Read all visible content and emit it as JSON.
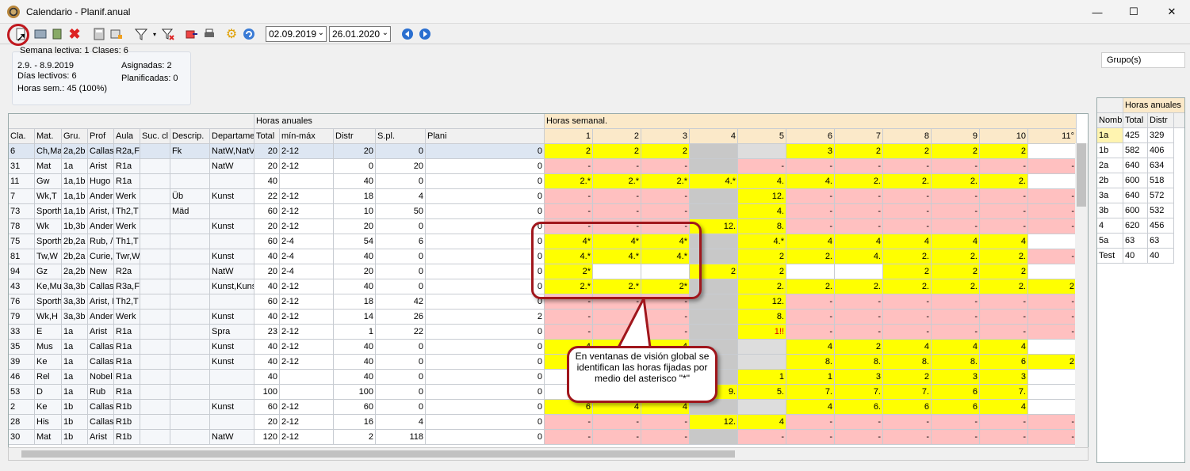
{
  "window": {
    "title": "Calendario - Planif.anual",
    "min": "—",
    "max": "☐",
    "close": "✕"
  },
  "toolbar": {
    "date_from": "02.09.2019",
    "date_to": "26.01.2020",
    "dropdown_arrow": "⌄"
  },
  "info": {
    "semana": "Semana lectiva: 1",
    "clases": "Clases: 6",
    "rango": "2.9. - 8.9.2019",
    "dias": "Días lectivos: 6",
    "horas": "Horas sem.: 45 (100%)",
    "asignadas": "Asignadas: 2",
    "planificadas": "Planificadas: 0"
  },
  "grid": {
    "group_header_annual": "Horas anuales",
    "group_header_weekly": "Horas semanal.",
    "columns": [
      "Cla.",
      "Mat.",
      "Gru.",
      "Prof",
      "Aula",
      "Suc. cl",
      "Descrip.",
      "Departame",
      "Total",
      "mín-máx",
      "Distr",
      "S.pl.",
      "Plani"
    ],
    "week_columns": [
      "1",
      "2",
      "3",
      "4",
      "5",
      "6",
      "7",
      "8",
      "9",
      "10",
      "11°"
    ],
    "rows": [
      {
        "c": [
          "6",
          "Ch,Ma",
          "2a,2b",
          "Callas",
          "R2a,F",
          "",
          "Fk",
          "NatW,NatV",
          "20",
          "2-12",
          "20",
          "0",
          "0"
        ],
        "w": [
          "2",
          "2",
          "2",
          "",
          "",
          "3",
          "2",
          "2",
          "2",
          "2",
          ""
        ]
      },
      {
        "c": [
          "31",
          "Mat",
          "1a",
          "Arist",
          "R1a",
          "",
          "",
          "NatW",
          "20",
          "2-12",
          "0",
          "20",
          "0"
        ],
        "w": [
          "-",
          "-",
          "-",
          "",
          "-",
          "-",
          "-",
          "-",
          "-",
          "-",
          "-"
        ]
      },
      {
        "c": [
          "11",
          "Gw",
          "1a,1b",
          "Hugo",
          "R1a",
          "",
          "",
          "",
          "40",
          "",
          "40",
          "0",
          "0"
        ],
        "w": [
          "2.*",
          "2.*",
          "2.*",
          "4.*",
          "4.",
          "4.",
          "2.",
          "2.",
          "2.",
          "2.",
          ""
        ]
      },
      {
        "c": [
          "7",
          "Wk,T",
          "1a,1b",
          "Ander",
          "Werk",
          "",
          "Üb",
          "Kunst",
          "22",
          "2-12",
          "18",
          "4",
          "0"
        ],
        "w": [
          "-",
          "-",
          "-",
          "",
          "12.",
          "-",
          "-",
          "-",
          "-",
          "-",
          "-"
        ]
      },
      {
        "c": [
          "73",
          "Sporth",
          "1a,1b",
          "Arist, I",
          "Th2,T",
          "",
          "Mäd",
          "",
          "60",
          "2-12",
          "10",
          "50",
          "0"
        ],
        "w": [
          "-",
          "-",
          "-",
          "",
          "4.",
          "-",
          "-",
          "-",
          "-",
          "-",
          "-"
        ]
      },
      {
        "c": [
          "78",
          "Wk",
          "1b,3b",
          "Ander",
          "Werk",
          "",
          "",
          "Kunst",
          "20",
          "2-12",
          "20",
          "0",
          "0"
        ],
        "w": [
          "-",
          "-",
          "-",
          "12.",
          "8.",
          "-",
          "-",
          "-",
          "-",
          "-",
          "-"
        ]
      },
      {
        "c": [
          "75",
          "Sporth",
          "2b,2a",
          "Rub, /",
          "Th1,T",
          "",
          "",
          "",
          "60",
          "2-4",
          "54",
          "6",
          "0"
        ],
        "w": [
          "4*",
          "4*",
          "4*",
          "",
          "4.*",
          "4",
          "4",
          "4",
          "4",
          "4",
          ""
        ]
      },
      {
        "c": [
          "81",
          "Tw,W",
          "2b,2a",
          "Curie,",
          "Twr,W",
          "",
          "",
          "Kunst",
          "40",
          "2-4",
          "40",
          "0",
          "0"
        ],
        "w": [
          "4.*",
          "4.*",
          "4.*",
          "",
          "2",
          "2.",
          "4.",
          "2.",
          "2.",
          "2.",
          "-"
        ]
      },
      {
        "c": [
          "94",
          "Gz",
          "2a,2b",
          "New",
          "R2a",
          "",
          "",
          "NatW",
          "20",
          "2-4",
          "20",
          "0",
          "0"
        ],
        "w": [
          "2*",
          "",
          "",
          "2",
          "2",
          "",
          "",
          "2",
          "2",
          "2",
          ""
        ]
      },
      {
        "c": [
          "43",
          "Ke,Mu",
          "3a,3b",
          "Callas",
          "R3a,F",
          "",
          "",
          "Kunst,Kuns",
          "40",
          "2-12",
          "40",
          "0",
          "0"
        ],
        "w": [
          "2.*",
          "2.*",
          "2*",
          "",
          "2.",
          "2.",
          "2.",
          "2.",
          "2.",
          "2.",
          "2"
        ]
      },
      {
        "c": [
          "76",
          "Sporth",
          "3a,3b",
          "Arist, I",
          "Th2,T",
          "",
          "",
          "",
          "60",
          "2-12",
          "18",
          "42",
          "0"
        ],
        "w": [
          "-",
          "-",
          "-",
          "",
          "12.",
          "-",
          "-",
          "-",
          "-",
          "-",
          "-"
        ]
      },
      {
        "c": [
          "79",
          "Wk,H",
          "3a,3b",
          "Ander",
          "Werk",
          "",
          "",
          "Kunst",
          "40",
          "2-12",
          "14",
          "26",
          "2"
        ],
        "w": [
          "-",
          "-",
          "-",
          "",
          "8.",
          "-",
          "-",
          "-",
          "-",
          "-",
          "-"
        ]
      },
      {
        "c": [
          "33",
          "E",
          "1a",
          "Arist",
          "R1a",
          "",
          "",
          "Spra",
          "23",
          "2-12",
          "1",
          "22",
          "0"
        ],
        "w": [
          "-",
          "-",
          "-",
          "",
          "1!!",
          "-",
          "-",
          "-",
          "-",
          "-",
          "-"
        ]
      },
      {
        "c": [
          "35",
          "Mus",
          "1a",
          "Callas",
          "R1a",
          "",
          "",
          "Kunst",
          "40",
          "2-12",
          "40",
          "0",
          "0"
        ],
        "w": [
          "4",
          "2",
          "4",
          "",
          "",
          "4",
          "2",
          "4",
          "4",
          "4",
          ""
        ]
      },
      {
        "c": [
          "39",
          "Ke",
          "1a",
          "Callas",
          "R1a",
          "",
          "",
          "Kunst",
          "40",
          "2-12",
          "40",
          "0",
          "0"
        ],
        "w": [
          "8.",
          "8.",
          "8.",
          "",
          "",
          "8.",
          "8.",
          "8.",
          "8.",
          "6",
          "2"
        ]
      },
      {
        "c": [
          "46",
          "Rel",
          "1a",
          "Nobel",
          "R1a",
          "",
          "",
          "",
          "40",
          "",
          "40",
          "0",
          "0"
        ],
        "w": [
          "",
          "",
          "",
          "",
          "1",
          "1",
          "3",
          "2",
          "3",
          "3",
          ""
        ]
      },
      {
        "c": [
          "53",
          "D",
          "1a",
          "Rub",
          "R1a",
          "",
          "",
          "",
          "100",
          "",
          "100",
          "0",
          "0"
        ],
        "w": [
          "",
          "",
          "",
          "9.",
          "5.",
          "7.",
          "7.",
          "7.",
          "6",
          "7.",
          ""
        ]
      },
      {
        "c": [
          "2",
          "Ke",
          "1b",
          "Callas",
          "R1b",
          "",
          "",
          "Kunst",
          "60",
          "2-12",
          "60",
          "0",
          "0"
        ],
        "w": [
          "6",
          "4",
          "4",
          "",
          "",
          "4",
          "6.",
          "6",
          "6",
          "4",
          ""
        ]
      },
      {
        "c": [
          "28",
          "His",
          "1b",
          "Callas",
          "R1b",
          "",
          "",
          "",
          "20",
          "2-12",
          "16",
          "4",
          "0"
        ],
        "w": [
          "-",
          "-",
          "-",
          "12.",
          "4",
          "-",
          "-",
          "-",
          "-",
          "-",
          "-"
        ]
      },
      {
        "c": [
          "30",
          "Mat",
          "1b",
          "Arist",
          "R1b",
          "",
          "",
          "NatW",
          "120",
          "2-12",
          "2",
          "118",
          "0"
        ],
        "w": [
          "-",
          "-",
          "-",
          "",
          "-",
          "-",
          "-",
          "-",
          "-",
          "-",
          "-"
        ]
      }
    ]
  },
  "callout": {
    "text": "En ventanas de visión global se identifican las horas fijadas por medio del asterisco \"*\""
  },
  "right_panel": {
    "grupo": "Grupo(s)",
    "header": "Horas anuales",
    "columns": [
      "Nomb",
      "Total",
      "Distr"
    ],
    "rows": [
      [
        "1a",
        "425",
        "329"
      ],
      [
        "1b",
        "582",
        "406"
      ],
      [
        "2a",
        "640",
        "634"
      ],
      [
        "2b",
        "600",
        "518"
      ],
      [
        "3a",
        "640",
        "572"
      ],
      [
        "3b",
        "600",
        "532"
      ],
      [
        "4",
        "620",
        "456"
      ],
      [
        "5a",
        "63",
        "63"
      ],
      [
        "Test",
        "40",
        "40"
      ]
    ]
  },
  "colors": {
    "yellow": "#ffff00",
    "pink": "#ffc0c0",
    "gray": "#c8c8c8",
    "selected": "#dde6f2",
    "callout_border": "#a0161c"
  }
}
